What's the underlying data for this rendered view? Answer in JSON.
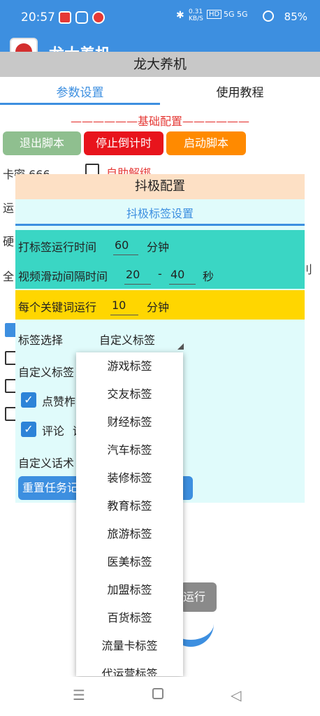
{
  "status_bar": {
    "time": "20:57",
    "net_speed": "0.31 KB/S",
    "signal": "5G 5G",
    "battery": "85%"
  },
  "app": {
    "header_title": "龙大养机",
    "title": "龙大养机"
  },
  "tabs": [
    {
      "label": "参数设置",
      "active": true
    },
    {
      "label": "使用教程",
      "active": false
    }
  ],
  "section_basic": "——————基础配置——————",
  "buttons": {
    "exit": "退出脚本",
    "stop": "停止倒计时",
    "start": "启动脚本"
  },
  "background": {
    "card_label": "卡密  666",
    "self_unbind": "自助解绑",
    "frag_run": "运",
    "frag_hard": "硬",
    "frag_full": "全",
    "frag_right": "刂",
    "run_button": "运行"
  },
  "dialog": {
    "title": "抖极配置",
    "subtitle": "抖极标签设置",
    "tag_run_time": {
      "label": "打标签运行时间",
      "value": "60",
      "unit": "分钟"
    },
    "swipe_interval": {
      "label": "视频滑动间隔时间",
      "min": "20",
      "sep": "-",
      "max": "40",
      "unit": "秒"
    },
    "keyword_run": {
      "label": "每个关键词运行",
      "value": "10",
      "unit": "分钟"
    },
    "tag_select_label": "标签选择",
    "tag_select_value": "自定义标签",
    "custom_tag_label": "自定义标签",
    "like_label": "点赞",
    "like_frag": "柞",
    "comment_label": "评论",
    "comment_frag": "评",
    "custom_script_label": "自定义话术",
    "reset_button": "重置任务记"
  },
  "dropdown_options": [
    "游戏标签",
    "交友标签",
    "财经标签",
    "汽车标签",
    "装修标签",
    "教育标签",
    "旅游标签",
    "医美标签",
    "加盟标签",
    "百货标签",
    "流量卡标签",
    "代运营标签"
  ],
  "colors": {
    "primary": "#3d8fe0",
    "exit_btn": "#8fbf8f",
    "stop_btn": "#e8141c",
    "start_btn": "#ff8a00",
    "teal_row": "#3ad6c4",
    "yellow_row": "#ffd600",
    "dialog_bg": "#e0fbfb",
    "dialog_header": "#fde0c5"
  }
}
